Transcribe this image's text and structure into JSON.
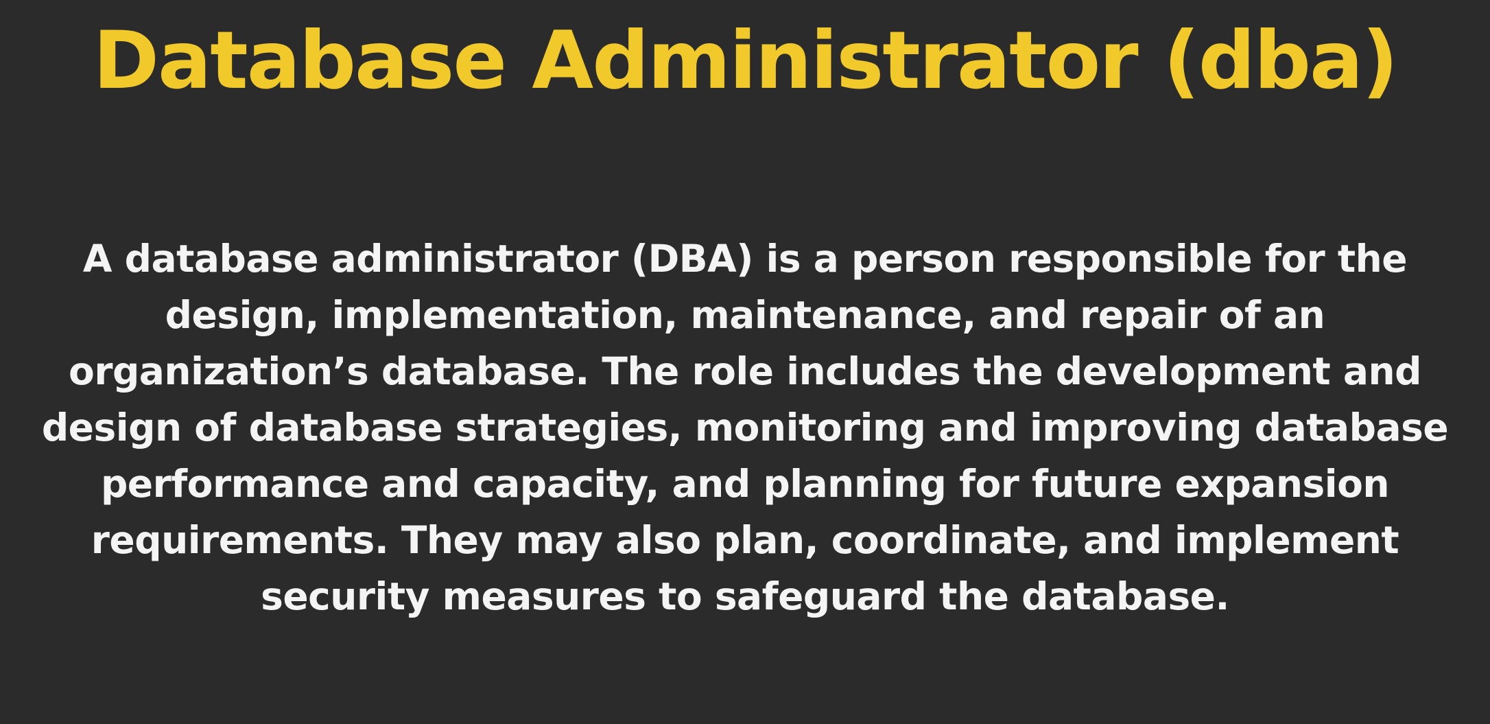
{
  "slide": {
    "title": "Database Administrator (dba)",
    "colors": {
      "background": "#2b2b2b",
      "title": "#f2c92a",
      "body": "#f4f4f4"
    },
    "body_lines": [
      "A database administrator (DBA) is a person responsible for the",
      "design, implementation, maintenance, and repair of an",
      "organization’s database. The role includes the development and",
      "design of database strategies, monitoring and improving database",
      "performance and capacity, and planning for future expansion",
      "requirements. They may also plan, coordinate, and implement",
      "security measures to safeguard the database."
    ]
  }
}
